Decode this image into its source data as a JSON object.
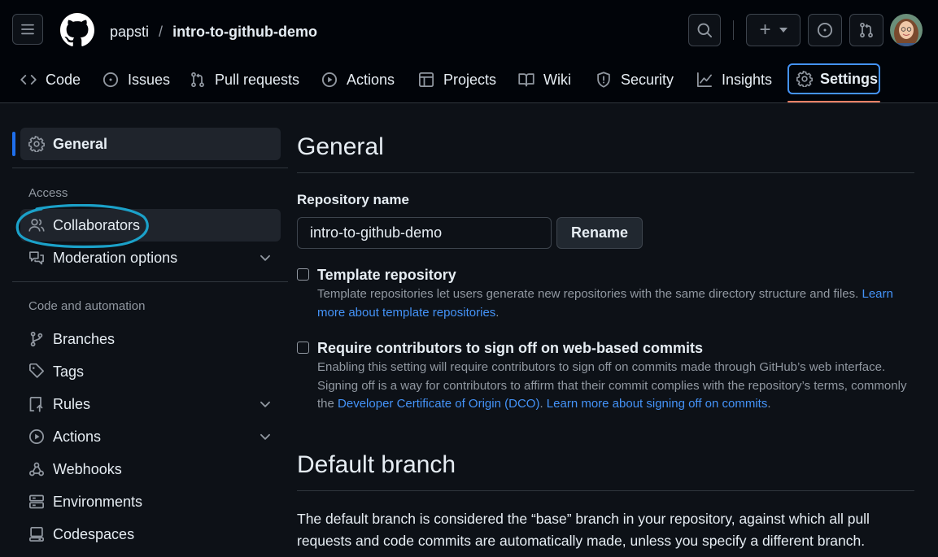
{
  "header": {
    "owner": "papsti",
    "separator": "/",
    "repo": "intro-to-github-demo",
    "plus_label": "+"
  },
  "tabs": [
    {
      "label": "Code",
      "icon": "code-icon"
    },
    {
      "label": "Issues",
      "icon": "issue-icon"
    },
    {
      "label": "Pull requests",
      "icon": "pull-request-icon"
    },
    {
      "label": "Actions",
      "icon": "play-icon"
    },
    {
      "label": "Projects",
      "icon": "table-icon"
    },
    {
      "label": "Wiki",
      "icon": "book-icon"
    },
    {
      "label": "Security",
      "icon": "shield-icon"
    },
    {
      "label": "Insights",
      "icon": "graph-icon"
    },
    {
      "label": "Settings",
      "icon": "gear-icon",
      "selected": true
    }
  ],
  "sidebar": {
    "general": "General",
    "access_heading": "Access",
    "collaborators": "Collaborators",
    "moderation": "Moderation options",
    "code_heading": "Code and automation",
    "branches": "Branches",
    "tags": "Tags",
    "rules": "Rules",
    "actions": "Actions",
    "webhooks": "Webhooks",
    "environments": "Environments",
    "codespaces": "Codespaces"
  },
  "main": {
    "title": "General",
    "repo_name_label": "Repository name",
    "repo_name_value": "intro-to-github-demo",
    "rename_button": "Rename",
    "template": {
      "label": "Template repository",
      "desc": "Template repositories let users generate new repositories with the same directory structure and files.",
      "link": "Learn more about template repositories",
      "end": "."
    },
    "signoff": {
      "label": "Require contributors to sign off on web-based commits",
      "desc": "Enabling this setting will require contributors to sign off on commits made through GitHub’s web interface. Signing off is a way for contributors to affirm that their commit complies with the repository’s terms, commonly the",
      "link1": "Developer Certificate of Origin (DCO)",
      "mid": ".",
      "link2": "Learn more about signing off on commits",
      "end": "."
    },
    "default_branch_title": "Default branch",
    "default_branch_desc": "The default branch is considered the “base” branch in your repository, against which all pull requests and code commits are automatically made, unless you specify a different branch."
  },
  "colors": {
    "background": "#0d1117",
    "accent_link": "#4493f8",
    "selected_underline": "#f78166",
    "annotation_circle": "#1ba1c9",
    "sidebar_active_bar": "#1f6feb"
  }
}
